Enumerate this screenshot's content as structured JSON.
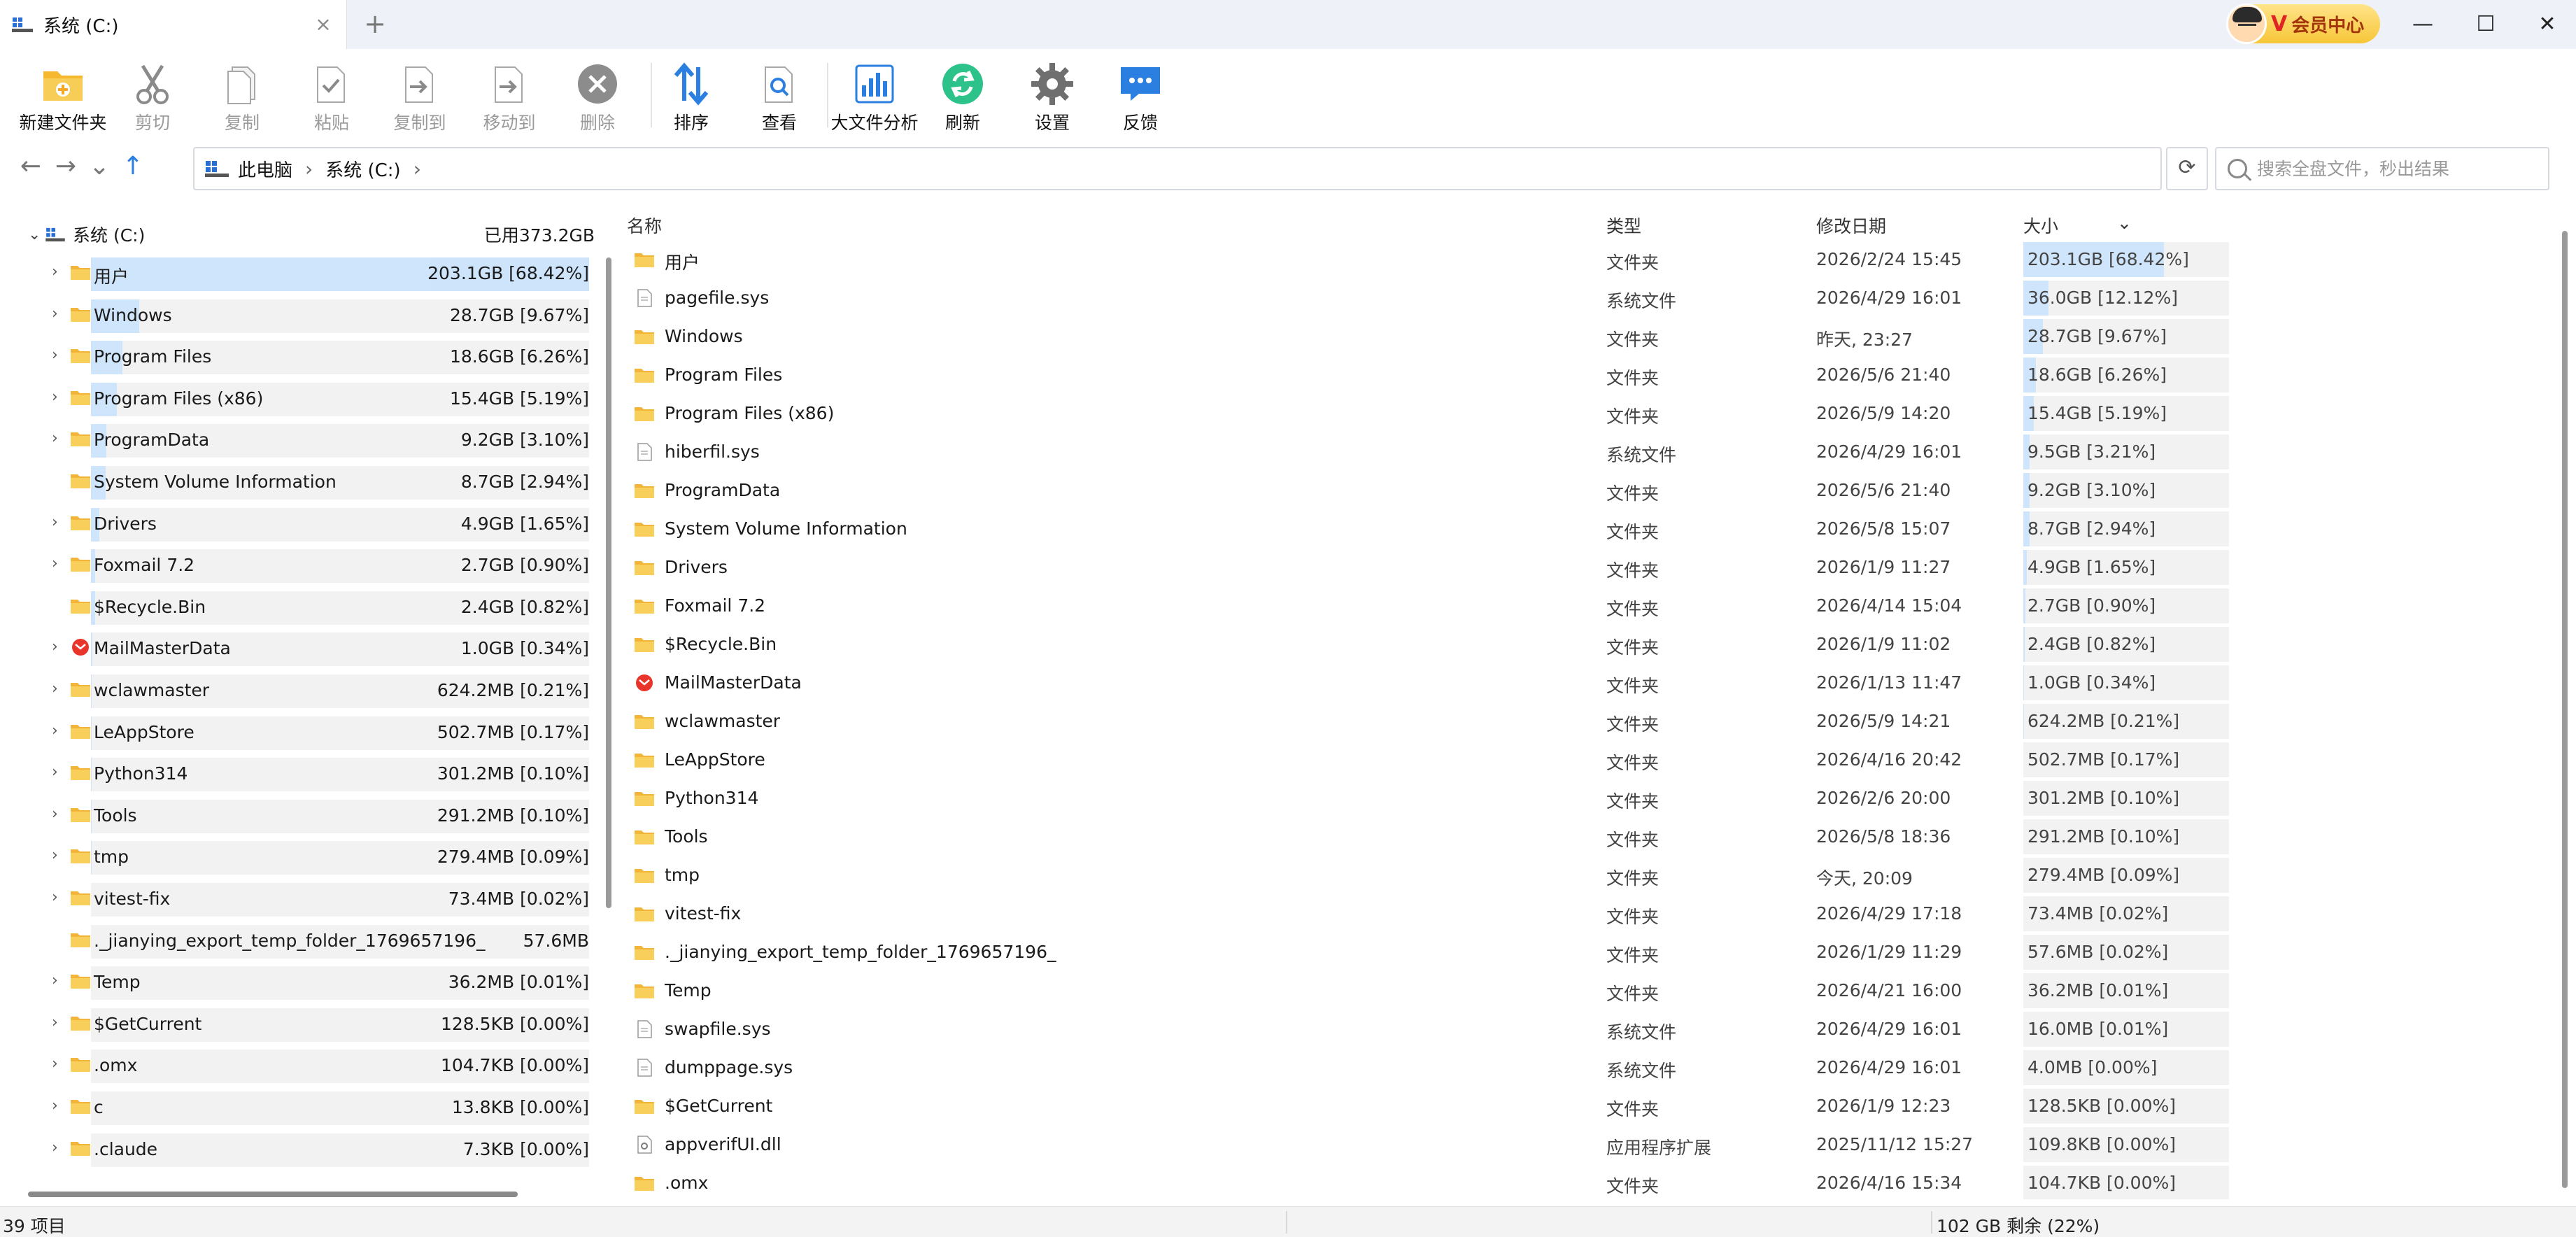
{
  "window": {
    "tab_title": "系统 (C:)",
    "new_tab": "+",
    "close_tab": "×",
    "vip_label": "会员中心",
    "vip_badge": "V",
    "minimize": "—",
    "maximize": "☐",
    "close": "✕"
  },
  "toolbar": {
    "items": [
      {
        "label": "新建文件夹",
        "icon": "new-folder-icon",
        "enabled": true
      },
      {
        "label": "剪切",
        "icon": "scissors-icon",
        "enabled": false
      },
      {
        "label": "复制",
        "icon": "copy-icon",
        "enabled": false
      },
      {
        "label": "粘贴",
        "icon": "paste-icon",
        "enabled": false
      },
      {
        "label": "复制到",
        "icon": "copy-to-icon",
        "enabled": false
      },
      {
        "label": "移动到",
        "icon": "move-to-icon",
        "enabled": false
      },
      {
        "label": "删除",
        "icon": "delete-icon",
        "enabled": false
      },
      {
        "label": "排序",
        "icon": "sort-icon",
        "enabled": true
      },
      {
        "label": "查看",
        "icon": "view-icon",
        "enabled": true
      },
      {
        "label": "大文件分析",
        "icon": "chart-icon",
        "enabled": true
      },
      {
        "label": "刷新",
        "icon": "refresh-icon",
        "enabled": true
      },
      {
        "label": "设置",
        "icon": "gear-icon",
        "enabled": true
      },
      {
        "label": "反馈",
        "icon": "feedback-icon",
        "enabled": true
      }
    ]
  },
  "nav": {
    "back": "←",
    "forward": "→",
    "history": "⌄",
    "up": "↑",
    "breadcrumb": [
      "此电脑",
      "系统 (C:)"
    ],
    "crumb_sep": "›",
    "refresh": "⟳",
    "search_placeholder": "搜索全盘文件，秒出结果"
  },
  "tree": {
    "root_name": "系统 (C:)",
    "root_used": "已用373.2GB",
    "items": [
      {
        "name": "用户",
        "size": "203.1GB [68.42%]",
        "pct": 68.42,
        "expandable": true,
        "icon": "folder",
        "selected": true
      },
      {
        "name": "Windows",
        "size": "28.7GB [9.67%]",
        "pct": 9.67,
        "expandable": true,
        "icon": "folder"
      },
      {
        "name": "Program Files",
        "size": "18.6GB [6.26%]",
        "pct": 6.26,
        "expandable": true,
        "icon": "folder"
      },
      {
        "name": "Program Files (x86)",
        "size": "15.4GB [5.19%]",
        "pct": 5.19,
        "expandable": true,
        "icon": "folder"
      },
      {
        "name": "ProgramData",
        "size": "9.2GB [3.10%]",
        "pct": 3.1,
        "expandable": true,
        "icon": "folder"
      },
      {
        "name": "System Volume Information",
        "size": "8.7GB [2.94%]",
        "pct": 2.94,
        "expandable": false,
        "icon": "folder"
      },
      {
        "name": "Drivers",
        "size": "4.9GB [1.65%]",
        "pct": 1.65,
        "expandable": true,
        "icon": "folder"
      },
      {
        "name": "Foxmail 7.2",
        "size": "2.7GB [0.90%]",
        "pct": 0.9,
        "expandable": true,
        "icon": "folder"
      },
      {
        "name": "$Recycle.Bin",
        "size": "2.4GB [0.82%]",
        "pct": 0.82,
        "expandable": false,
        "icon": "folder"
      },
      {
        "name": "MailMasterData",
        "size": "1.0GB [0.34%]",
        "pct": 0.34,
        "expandable": true,
        "icon": "mailmaster"
      },
      {
        "name": "wclawmaster",
        "size": "624.2MB [0.21%]",
        "pct": 0.21,
        "expandable": true,
        "icon": "folder"
      },
      {
        "name": "LeAppStore",
        "size": "502.7MB [0.17%]",
        "pct": 0.17,
        "expandable": true,
        "icon": "folder"
      },
      {
        "name": "Python314",
        "size": "301.2MB [0.10%]",
        "pct": 0.1,
        "expandable": true,
        "icon": "folder"
      },
      {
        "name": "Tools",
        "size": "291.2MB [0.10%]",
        "pct": 0.1,
        "expandable": true,
        "icon": "folder"
      },
      {
        "name": "tmp",
        "size": "279.4MB [0.09%]",
        "pct": 0.09,
        "expandable": true,
        "icon": "folder"
      },
      {
        "name": "vitest-fix",
        "size": "73.4MB [0.02%]",
        "pct": 0.02,
        "expandable": true,
        "icon": "folder"
      },
      {
        "name": "._jianying_export_temp_folder_1769657196_",
        "size": "57.6MB",
        "pct": 0.02,
        "expandable": false,
        "icon": "folder"
      },
      {
        "name": "Temp",
        "size": "36.2MB [0.01%]",
        "pct": 0.01,
        "expandable": true,
        "icon": "folder"
      },
      {
        "name": "$GetCurrent",
        "size": "128.5KB [0.00%]",
        "pct": 0,
        "expandable": true,
        "icon": "folder"
      },
      {
        "name": ".omx",
        "size": "104.7KB [0.00%]",
        "pct": 0,
        "expandable": true,
        "icon": "folder"
      },
      {
        "name": "c",
        "size": "13.8KB [0.00%]",
        "pct": 0,
        "expandable": true,
        "icon": "folder"
      },
      {
        "name": ".claude",
        "size": "7.3KB [0.00%]",
        "pct": 0,
        "expandable": true,
        "icon": "folder"
      }
    ]
  },
  "list": {
    "headers": {
      "name": "名称",
      "type": "类型",
      "date": "修改日期",
      "size": "大小"
    },
    "sort_arrow": "⌄",
    "rows": [
      {
        "name": "用户",
        "type": "文件夹",
        "date": "2026/2/24 15:45",
        "size": "203.1GB [68.42%]",
        "pct": 68.42,
        "icon": "folder"
      },
      {
        "name": "pagefile.sys",
        "type": "系统文件",
        "date": "2026/4/29 16:01",
        "size": "36.0GB [12.12%]",
        "pct": 12.12,
        "icon": "file"
      },
      {
        "name": "Windows",
        "type": "文件夹",
        "date": "昨天, 23:27",
        "size": "28.7GB [9.67%]",
        "pct": 9.67,
        "icon": "folder"
      },
      {
        "name": "Program Files",
        "type": "文件夹",
        "date": "2026/5/6 21:40",
        "size": "18.6GB [6.26%]",
        "pct": 6.26,
        "icon": "folder"
      },
      {
        "name": "Program Files (x86)",
        "type": "文件夹",
        "date": "2026/5/9 14:20",
        "size": "15.4GB [5.19%]",
        "pct": 5.19,
        "icon": "folder"
      },
      {
        "name": "hiberfil.sys",
        "type": "系统文件",
        "date": "2026/4/29 16:01",
        "size": "9.5GB [3.21%]",
        "pct": 3.21,
        "icon": "file"
      },
      {
        "name": "ProgramData",
        "type": "文件夹",
        "date": "2026/5/6 21:40",
        "size": "9.2GB [3.10%]",
        "pct": 3.1,
        "icon": "folder"
      },
      {
        "name": "System Volume Information",
        "type": "文件夹",
        "date": "2026/5/8 15:07",
        "size": "8.7GB [2.94%]",
        "pct": 2.94,
        "icon": "folder"
      },
      {
        "name": "Drivers",
        "type": "文件夹",
        "date": "2026/1/9 11:27",
        "size": "4.9GB [1.65%]",
        "pct": 1.65,
        "icon": "folder"
      },
      {
        "name": "Foxmail 7.2",
        "type": "文件夹",
        "date": "2026/4/14 15:04",
        "size": "2.7GB [0.90%]",
        "pct": 0.9,
        "icon": "folder"
      },
      {
        "name": "$Recycle.Bin",
        "type": "文件夹",
        "date": "2026/1/9 11:02",
        "size": "2.4GB [0.82%]",
        "pct": 0.82,
        "icon": "folder"
      },
      {
        "name": "MailMasterData",
        "type": "文件夹",
        "date": "2026/1/13 11:47",
        "size": "1.0GB [0.34%]",
        "pct": 0.34,
        "icon": "mailmaster"
      },
      {
        "name": "wclawmaster",
        "type": "文件夹",
        "date": "2026/5/9 14:21",
        "size": "624.2MB [0.21%]",
        "pct": 0.21,
        "icon": "folder"
      },
      {
        "name": "LeAppStore",
        "type": "文件夹",
        "date": "2026/4/16 20:42",
        "size": "502.7MB [0.17%]",
        "pct": 0.17,
        "icon": "folder"
      },
      {
        "name": "Python314",
        "type": "文件夹",
        "date": "2026/2/6 20:00",
        "size": "301.2MB [0.10%]",
        "pct": 0.1,
        "icon": "folder"
      },
      {
        "name": "Tools",
        "type": "文件夹",
        "date": "2026/5/8 18:36",
        "size": "291.2MB [0.10%]",
        "pct": 0.1,
        "icon": "folder"
      },
      {
        "name": "tmp",
        "type": "文件夹",
        "date": "今天, 20:09",
        "size": "279.4MB [0.09%]",
        "pct": 0.09,
        "icon": "folder"
      },
      {
        "name": "vitest-fix",
        "type": "文件夹",
        "date": "2026/4/29 17:18",
        "size": "73.4MB [0.02%]",
        "pct": 0.02,
        "icon": "folder"
      },
      {
        "name": "._jianying_export_temp_folder_1769657196_",
        "type": "文件夹",
        "date": "2026/1/29 11:29",
        "size": "57.6MB [0.02%]",
        "pct": 0.02,
        "icon": "folder"
      },
      {
        "name": "Temp",
        "type": "文件夹",
        "date": "2026/4/21 16:00",
        "size": "36.2MB [0.01%]",
        "pct": 0.01,
        "icon": "folder"
      },
      {
        "name": "swapfile.sys",
        "type": "系统文件",
        "date": "2026/4/29 16:01",
        "size": "16.0MB [0.01%]",
        "pct": 0.01,
        "icon": "file"
      },
      {
        "name": "dumppage.sys",
        "type": "系统文件",
        "date": "2026/4/29 16:01",
        "size": "4.0MB [0.00%]",
        "pct": 0,
        "icon": "file"
      },
      {
        "name": "$GetCurrent",
        "type": "文件夹",
        "date": "2026/1/9 12:23",
        "size": "128.5KB [0.00%]",
        "pct": 0,
        "icon": "folder"
      },
      {
        "name": "appverifUI.dll",
        "type": "应用程序扩展",
        "date": "2025/11/12 15:27",
        "size": "109.8KB [0.00%]",
        "pct": 0,
        "icon": "dll"
      },
      {
        "name": ".omx",
        "type": "文件夹",
        "date": "2026/4/16 15:34",
        "size": "104.7KB [0.00%]",
        "pct": 0,
        "icon": "folder"
      }
    ]
  },
  "status": {
    "items_count": "39 项目",
    "free_space": "102 GB 剩余 (22%)"
  },
  "colors": {
    "accent": "#1e88e5",
    "folder": "#f5c246",
    "bar_fill": "#cfe5fb",
    "bar_bg": "#f2f2f2",
    "selected": "#cde4fb"
  }
}
